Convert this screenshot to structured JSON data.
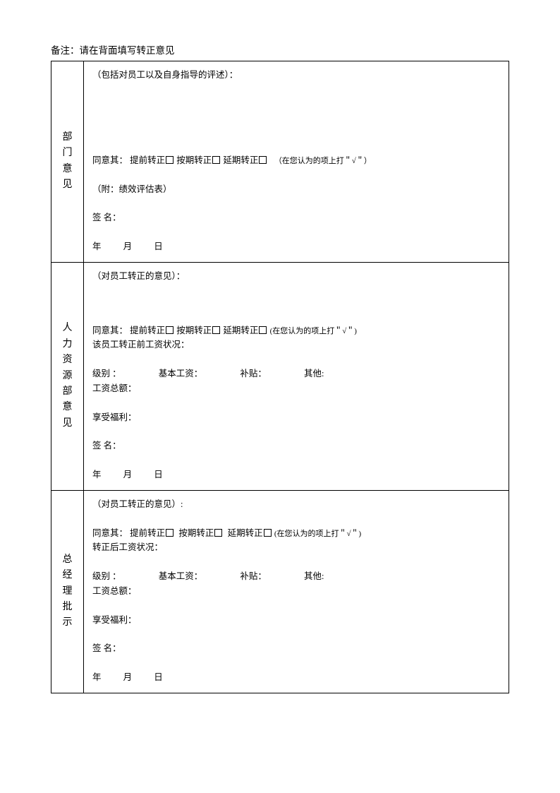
{
  "note": "备注：请在背面填写转正意见",
  "sections": [
    {
      "label": "部门意见",
      "intro": "（包括对员工以及自身指导的评述）：",
      "agree_prefix": "同意其：",
      "opt_early": "提前转正",
      "opt_ontime": "按期转正",
      "opt_delay": "延期转正",
      "hint": "（在您认为的项上打＂√＂）",
      "attach": "（附：绩效评估表）",
      "sign": "签   名：",
      "date_y": "年",
      "date_m": "月",
      "date_d": "日"
    },
    {
      "label": "人力资源部意见",
      "intro": "（对员工转正的意见）：",
      "agree_prefix": "同意其：",
      "opt_early": "提前转正",
      "opt_ontime": "按期转正",
      "opt_delay": "延期转正",
      "hint": "(在您认为的项上打＂√＂)",
      "salary_status": "该员工转正前工资状况：",
      "level": "级别 ：",
      "base_salary": "基本工资：",
      "allowance": "补贴：",
      "other": "其他:",
      "total_salary": "工资总额：",
      "benefits": "享受福利：",
      "sign": "签   名：",
      "date_y": "年",
      "date_m": "月",
      "date_d": "日"
    },
    {
      "label": "总经理批示",
      "intro": "（对员工转正的意见）:",
      "agree_prefix": "同意其：",
      "opt_early": "提前转正",
      "opt_ontime": "按期转正",
      "opt_delay": "延期转正",
      "hint": "(在您认为的项上打＂√＂)",
      "salary_status": "转正后工资状况：",
      "level": "级别 ：",
      "base_salary": "基本工资：",
      "allowance": "补贴：",
      "other": "其他:",
      "total_salary": "工资总额：",
      "benefits": "享受福利：",
      "sign": "签   名：",
      "date_y": "年",
      "date_m": "月",
      "date_d": "日"
    }
  ]
}
